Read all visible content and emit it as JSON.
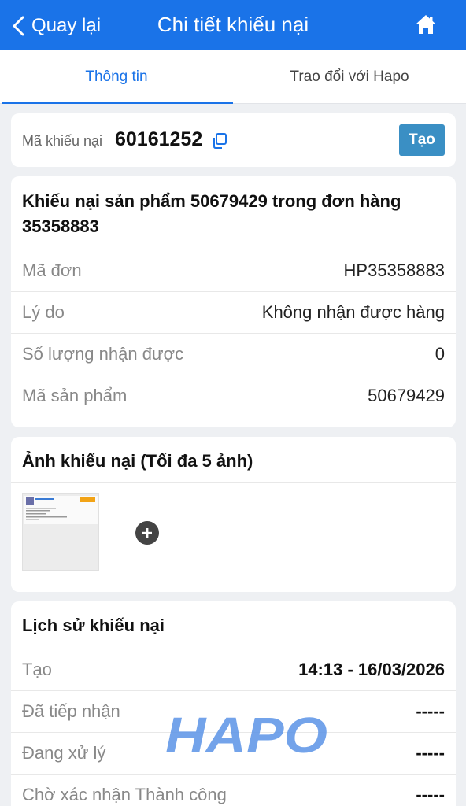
{
  "header": {
    "back_label": "Quay lại",
    "title": "Chi tiết khiếu nại",
    "bg_color": "#1a73e8"
  },
  "tabs": [
    {
      "label": "Thông tin",
      "active": true
    },
    {
      "label": "Trao đổi với Hapo",
      "active": false
    }
  ],
  "complaint_code": {
    "label": "Mã khiếu nại",
    "value": "60161252",
    "status_button": "Tạo"
  },
  "details": {
    "title": "Khiếu nại sản phẩm 50679429 trong đơn hàng 35358883",
    "rows": [
      {
        "label": "Mã đơn",
        "value": "HP35358883"
      },
      {
        "label": "Lý do",
        "value": "Không nhận được hàng"
      },
      {
        "label": "Số lượng nhận được",
        "value": "0"
      },
      {
        "label": "Mã sản phẩm",
        "value": "50679429"
      }
    ]
  },
  "images": {
    "title": "Ảnh khiếu nại (Tối đa 5 ảnh)"
  },
  "history": {
    "title": "Lịch sử khiếu nại",
    "rows": [
      {
        "label": "Tạo",
        "value": "14:13 - 16/03/2026"
      },
      {
        "label": "Đã tiếp nhận",
        "value": "-----"
      },
      {
        "label": "Đang xử lý",
        "value": "-----"
      },
      {
        "label": "Chờ xác nhận Thành công",
        "value": "-----"
      }
    ]
  },
  "watermark": {
    "text": "HAPO"
  }
}
